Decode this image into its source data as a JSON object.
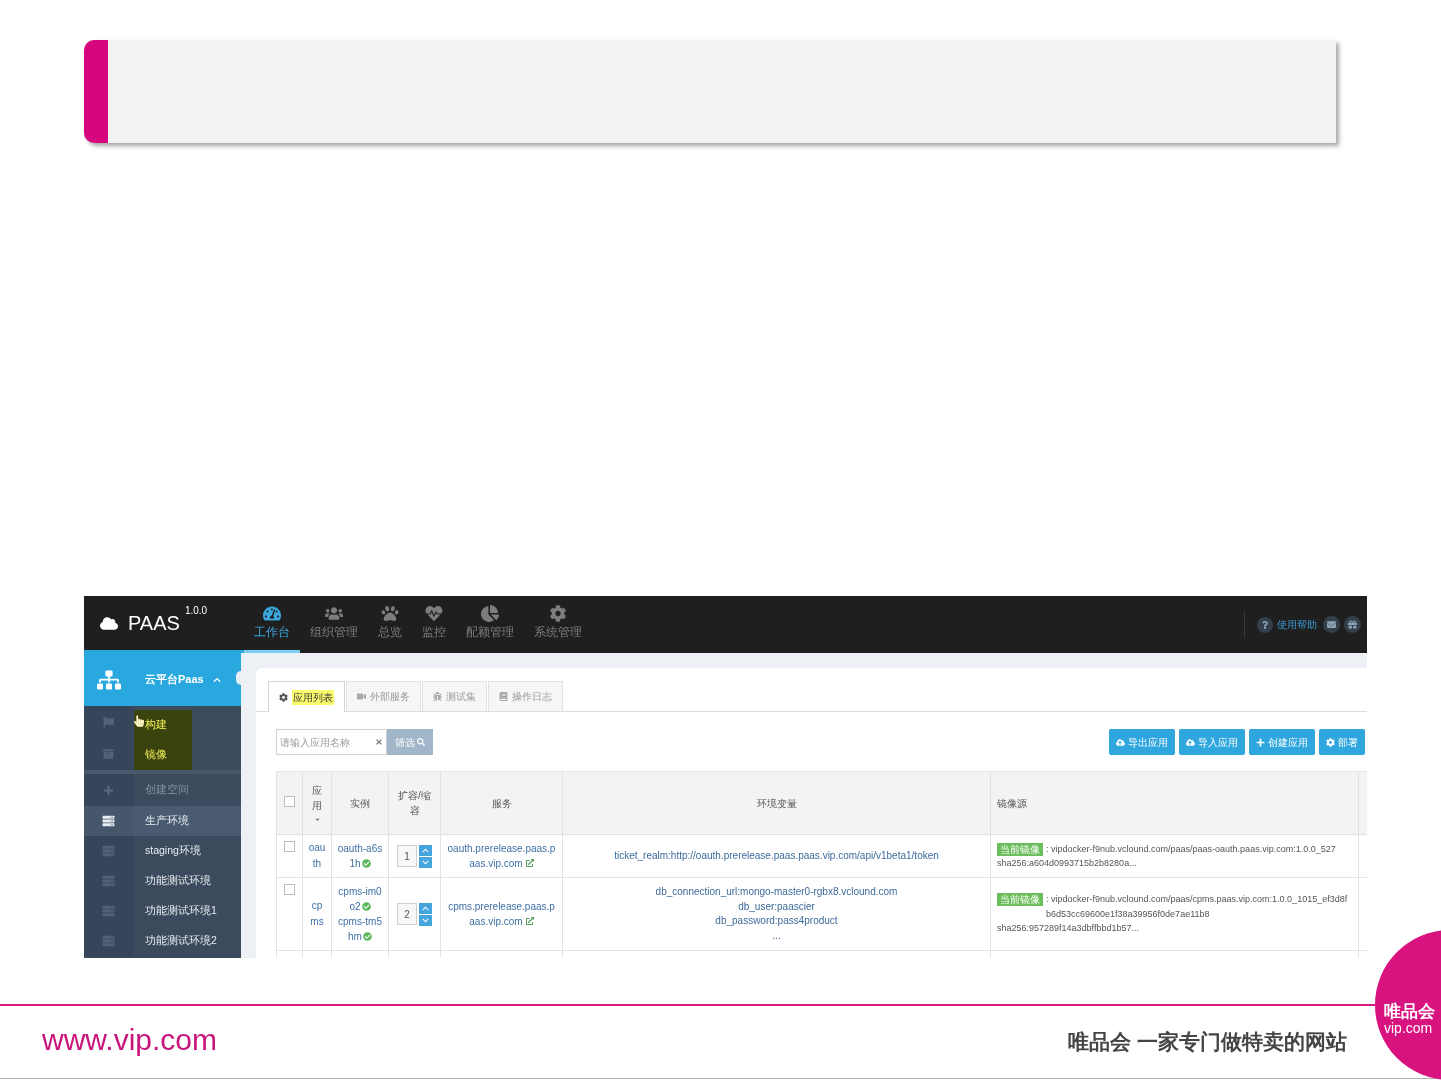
{
  "app": {
    "brand": {
      "name": "PAAS",
      "version": "1.0.0"
    },
    "nav": [
      {
        "label": "工作台",
        "selected": true
      },
      {
        "label": "组织管理",
        "selected": false
      },
      {
        "label": "总览",
        "selected": false
      },
      {
        "label": "监控",
        "selected": false
      },
      {
        "label": "配额管理",
        "selected": false
      },
      {
        "label": "系统管理",
        "selected": false
      }
    ],
    "help": {
      "label": "使用帮助"
    },
    "sidebar": {
      "project": "云平台Paas",
      "expanded": true,
      "submenu": [
        {
          "label": "构建"
        },
        {
          "label": "镜像"
        }
      ],
      "create": {
        "label": "创建空间",
        "disabled": true
      },
      "environments": [
        {
          "label": "生产环境",
          "selected": true
        },
        {
          "label": "staging环境",
          "selected": false
        },
        {
          "label": "功能测试环境",
          "selected": false
        },
        {
          "label": "功能测试环境1",
          "selected": false
        },
        {
          "label": "功能测试环境2",
          "selected": false
        }
      ]
    },
    "tabs": [
      {
        "label": "应用列表",
        "selected": true
      },
      {
        "label": "外部服务",
        "selected": false
      },
      {
        "label": "测试集",
        "selected": false
      },
      {
        "label": "操作日志",
        "selected": false
      }
    ],
    "search": {
      "placeholder": "请输入应用名称",
      "button": "筛选"
    },
    "actions": [
      "导出应用",
      "导入应用",
      "创建应用",
      "部署"
    ],
    "table": {
      "select_all_checked": false,
      "columns": [
        {
          "label": "应用",
          "sorted": true
        },
        {
          "label": "实例",
          "sorted": false
        },
        {
          "label": "扩容/缩容",
          "sorted": false
        },
        {
          "label": "服务",
          "sorted": false
        },
        {
          "label": "环境变量",
          "sorted": false
        },
        {
          "label": "镜像源",
          "sorted": false
        }
      ],
      "rows": [
        {
          "checked": false,
          "app": "oauth",
          "instances": [
            {
              "name": "oauth-a6s1h",
              "healthy": true
            }
          ],
          "replicas": "1",
          "service": "oauth.prerelease.paas.paas.vip.com",
          "env": [
            "ticket_realm:http://oauth.prerelease.paas.paas.vip.com/api/v1beta1/token"
          ],
          "image": {
            "badge": "当前镜像",
            "source": ": vipdocker-f9nub.vclound.com/paas/paas-oauth.paas.vip.com:1.0.0_527",
            "digest": "sha256:a604d0993715b2b8280a..."
          }
        },
        {
          "checked": false,
          "app": "cpms",
          "instances": [
            {
              "name": "cpms-im0o2",
              "healthy": true
            },
            {
              "name": "cpms-tm5hm",
              "healthy": true
            }
          ],
          "replicas": "2",
          "service": "cpms.prerelease.paas.paas.vip.com",
          "env": [
            "db_connection_url:mongo-master0-rgbx8.vclound.com",
            "db_user:paascier",
            "db_password:pass4product",
            "..."
          ],
          "image": {
            "badge": "当前镜像",
            "source": ": vipdocker-f9nub.vclound.com/paas/cpms.paas.vip.com:1.0.0_1015_ef3d8fb6d53cc69600e1f38a39956f0de7ae11b8",
            "digest": "sha256:957289f14a3dbffbbd1b57..."
          }
        }
      ]
    }
  },
  "footer": {
    "site": "www.vip.com",
    "slogan": "唯品会 一家专门做特卖的网站",
    "logo": {
      "name": "唯品会",
      "domain": "vip.com"
    }
  }
}
